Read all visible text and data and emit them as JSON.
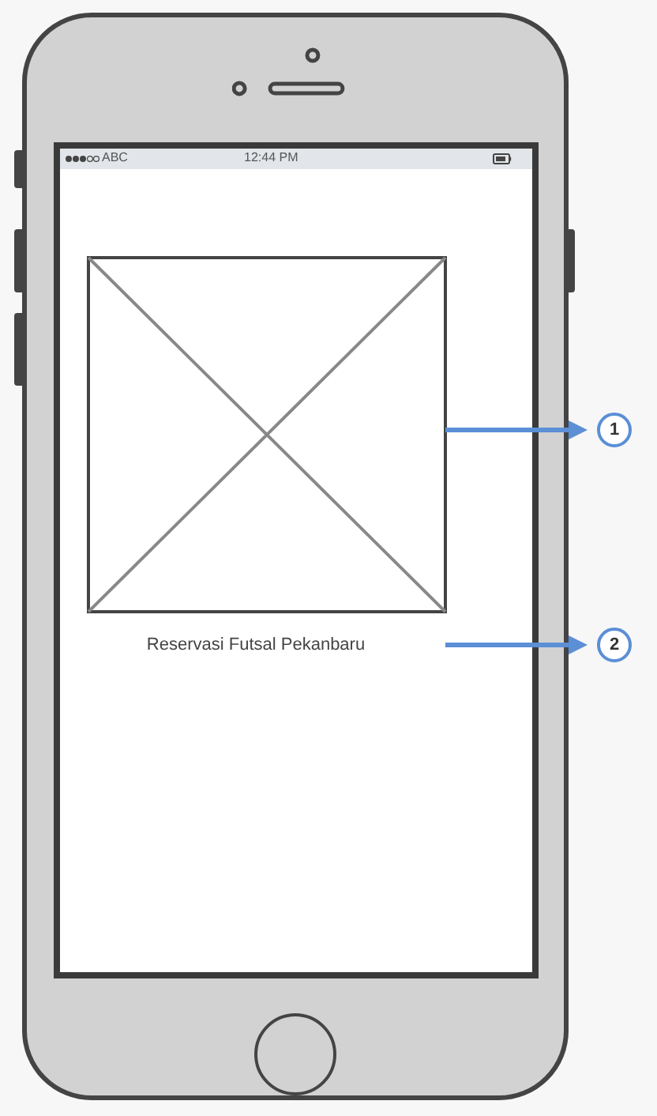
{
  "status_bar": {
    "carrier": "ABC",
    "time": "12:44 PM"
  },
  "screen": {
    "image": {
      "kind": "image-placeholder"
    },
    "title": "Reservasi Futsal Pekanbaru"
  },
  "annotations": [
    {
      "number": "1"
    },
    {
      "number": "2"
    }
  ]
}
